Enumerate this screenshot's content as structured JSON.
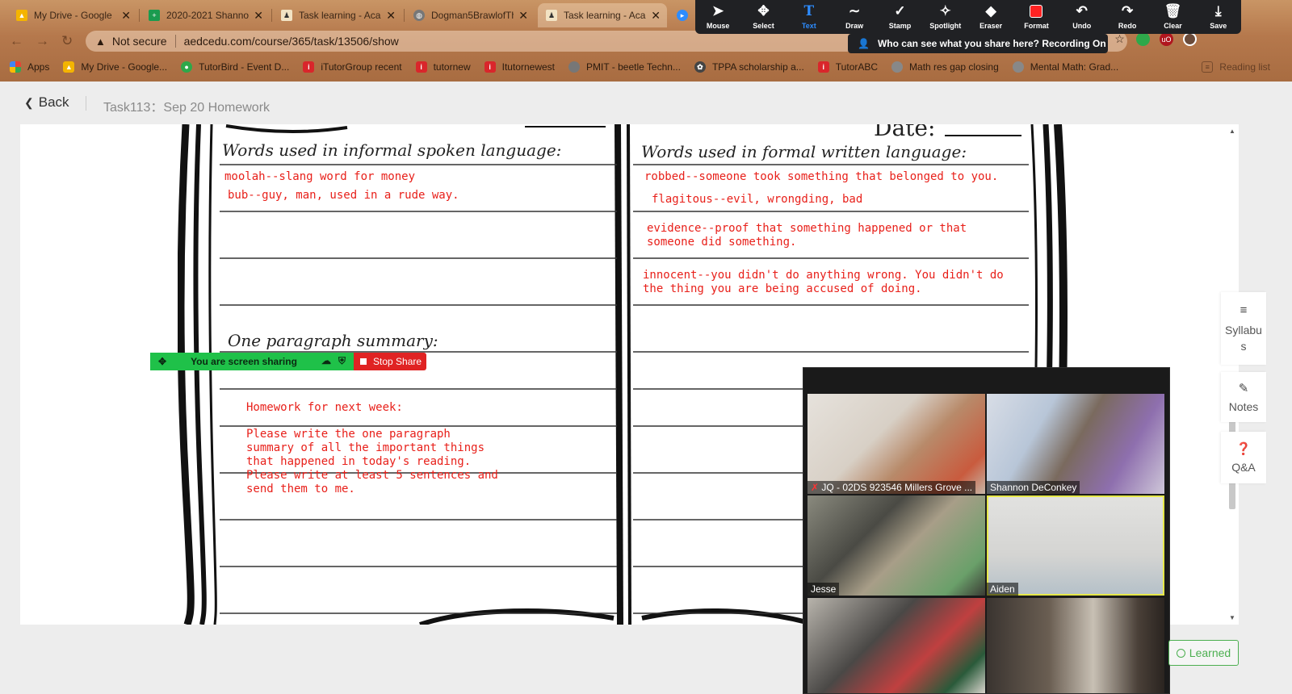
{
  "browser": {
    "tabs": [
      {
        "title": "My Drive - Google",
        "close": "✕"
      },
      {
        "title": "2020-2021 Shannon",
        "close": "✕"
      },
      {
        "title": "Task learning - Aca",
        "close": "✕"
      },
      {
        "title": "Dogman5BrawlofTh",
        "close": "✕"
      },
      {
        "title": "Task learning - Aca",
        "close": "✕"
      }
    ],
    "address": {
      "security": "Not secure",
      "url": "aedcedu.com/course/365/task/13506/show"
    },
    "bookmarks": [
      {
        "label": "Apps",
        "color": "#e8a33b"
      },
      {
        "label": "My Drive - Google...",
        "color": "#f4b400"
      },
      {
        "label": "TutorBird - Event D...",
        "color": "#2ea84a"
      },
      {
        "label": "iTutorGroup recent",
        "color": "#d9262b"
      },
      {
        "label": "tutornew",
        "color": "#d9262b"
      },
      {
        "label": "Itutornewest",
        "color": "#d9262b"
      },
      {
        "label": "PMIT - beetle Techn...",
        "color": "#777777"
      },
      {
        "label": "TPPA scholarship a...",
        "color": "#444444"
      },
      {
        "label": "TutorABC",
        "color": "#d9262b"
      },
      {
        "label": "Math res gap closing",
        "color": "#888888"
      },
      {
        "label": "Mental Math: Grad...",
        "color": "#888888"
      }
    ],
    "reading_list": "Reading list"
  },
  "zoom_toolbar": {
    "items": [
      {
        "label": "Mouse",
        "icon": "cursor-icon"
      },
      {
        "label": "Select",
        "icon": "move-icon"
      },
      {
        "label": "Text",
        "icon": "text-icon"
      },
      {
        "label": "Draw",
        "icon": "draw-icon"
      },
      {
        "label": "Stamp",
        "icon": "checkmark-icon"
      },
      {
        "label": "Spotlight",
        "icon": "spotlight-icon"
      },
      {
        "label": "Eraser",
        "icon": "eraser-icon"
      },
      {
        "label": "Format",
        "icon": "color-swatch-icon"
      },
      {
        "label": "Undo",
        "icon": "undo-icon"
      },
      {
        "label": "Redo",
        "icon": "redo-icon"
      },
      {
        "label": "Clear",
        "icon": "trash-icon"
      },
      {
        "label": "Save",
        "icon": "download-icon"
      }
    ],
    "active": "Text",
    "share_notice": "Who can see what you share here? Recording On"
  },
  "page": {
    "back_label": "Back",
    "title": "Task113：Sep 20 Homework"
  },
  "worksheet": {
    "date_label": "Date:",
    "left_heading": "Words used in informal spoken language:",
    "right_heading": "Words used in formal written language:",
    "summary_heading": "One paragraph summary:",
    "informal_entries": [
      "moolah--slang word for money",
      "bub--guy, man, used in a rude way."
    ],
    "formal_entries": [
      "robbed--someone took something that belonged to you.",
      "flagitous--evil, wrongding, bad",
      "evidence--proof that something happened or that someone did something.",
      "innocent--you didn't do anything wrong. You didn't do the thing you are being accused of doing."
    ],
    "homework_title": "Homework for next week:",
    "homework_body": "Please write the one paragraph summary of all the important things that happened in today's reading.  Please write at least 5 sentences and send them to me.",
    "ink_color": "#e8201a"
  },
  "sharing_bar": {
    "status": "You are screen sharing",
    "stop_label": "Stop Share"
  },
  "side_tools": [
    {
      "label": "Syllabus",
      "icon": "list-icon"
    },
    {
      "label": "Notes",
      "icon": "pencil-icon"
    },
    {
      "label": "Q&A",
      "icon": "question-icon"
    }
  ],
  "participants": [
    {
      "name": "JQ - 02DS 923546 Millers Grove ...",
      "muted": true
    },
    {
      "name": "Shannon DeConkey",
      "muted": false
    },
    {
      "name": "Jesse",
      "muted": false
    },
    {
      "name": "Aiden",
      "muted": false,
      "speaking": true
    },
    {
      "name": "",
      "muted": false
    },
    {
      "name": "",
      "muted": false
    }
  ],
  "learned_label": "Learned"
}
